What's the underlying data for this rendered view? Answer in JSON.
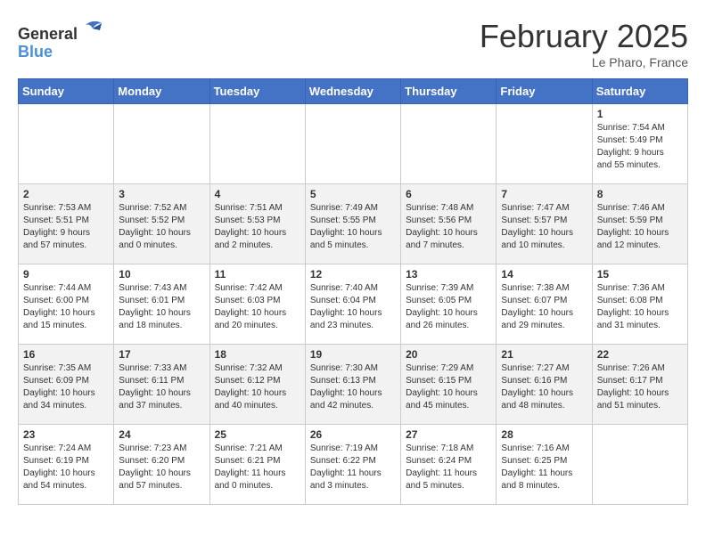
{
  "header": {
    "logo_general": "General",
    "logo_blue": "Blue",
    "month_title": "February 2025",
    "subtitle": "Le Pharo, France"
  },
  "weekdays": [
    "Sunday",
    "Monday",
    "Tuesday",
    "Wednesday",
    "Thursday",
    "Friday",
    "Saturday"
  ],
  "weeks": [
    [
      {
        "day": "",
        "info": ""
      },
      {
        "day": "",
        "info": ""
      },
      {
        "day": "",
        "info": ""
      },
      {
        "day": "",
        "info": ""
      },
      {
        "day": "",
        "info": ""
      },
      {
        "day": "",
        "info": ""
      },
      {
        "day": "1",
        "info": "Sunrise: 7:54 AM\nSunset: 5:49 PM\nDaylight: 9 hours\nand 55 minutes."
      }
    ],
    [
      {
        "day": "2",
        "info": "Sunrise: 7:53 AM\nSunset: 5:51 PM\nDaylight: 9 hours\nand 57 minutes."
      },
      {
        "day": "3",
        "info": "Sunrise: 7:52 AM\nSunset: 5:52 PM\nDaylight: 10 hours\nand 0 minutes."
      },
      {
        "day": "4",
        "info": "Sunrise: 7:51 AM\nSunset: 5:53 PM\nDaylight: 10 hours\nand 2 minutes."
      },
      {
        "day": "5",
        "info": "Sunrise: 7:49 AM\nSunset: 5:55 PM\nDaylight: 10 hours\nand 5 minutes."
      },
      {
        "day": "6",
        "info": "Sunrise: 7:48 AM\nSunset: 5:56 PM\nDaylight: 10 hours\nand 7 minutes."
      },
      {
        "day": "7",
        "info": "Sunrise: 7:47 AM\nSunset: 5:57 PM\nDaylight: 10 hours\nand 10 minutes."
      },
      {
        "day": "8",
        "info": "Sunrise: 7:46 AM\nSunset: 5:59 PM\nDaylight: 10 hours\nand 12 minutes."
      }
    ],
    [
      {
        "day": "9",
        "info": "Sunrise: 7:44 AM\nSunset: 6:00 PM\nDaylight: 10 hours\nand 15 minutes."
      },
      {
        "day": "10",
        "info": "Sunrise: 7:43 AM\nSunset: 6:01 PM\nDaylight: 10 hours\nand 18 minutes."
      },
      {
        "day": "11",
        "info": "Sunrise: 7:42 AM\nSunset: 6:03 PM\nDaylight: 10 hours\nand 20 minutes."
      },
      {
        "day": "12",
        "info": "Sunrise: 7:40 AM\nSunset: 6:04 PM\nDaylight: 10 hours\nand 23 minutes."
      },
      {
        "day": "13",
        "info": "Sunrise: 7:39 AM\nSunset: 6:05 PM\nDaylight: 10 hours\nand 26 minutes."
      },
      {
        "day": "14",
        "info": "Sunrise: 7:38 AM\nSunset: 6:07 PM\nDaylight: 10 hours\nand 29 minutes."
      },
      {
        "day": "15",
        "info": "Sunrise: 7:36 AM\nSunset: 6:08 PM\nDaylight: 10 hours\nand 31 minutes."
      }
    ],
    [
      {
        "day": "16",
        "info": "Sunrise: 7:35 AM\nSunset: 6:09 PM\nDaylight: 10 hours\nand 34 minutes."
      },
      {
        "day": "17",
        "info": "Sunrise: 7:33 AM\nSunset: 6:11 PM\nDaylight: 10 hours\nand 37 minutes."
      },
      {
        "day": "18",
        "info": "Sunrise: 7:32 AM\nSunset: 6:12 PM\nDaylight: 10 hours\nand 40 minutes."
      },
      {
        "day": "19",
        "info": "Sunrise: 7:30 AM\nSunset: 6:13 PM\nDaylight: 10 hours\nand 42 minutes."
      },
      {
        "day": "20",
        "info": "Sunrise: 7:29 AM\nSunset: 6:15 PM\nDaylight: 10 hours\nand 45 minutes."
      },
      {
        "day": "21",
        "info": "Sunrise: 7:27 AM\nSunset: 6:16 PM\nDaylight: 10 hours\nand 48 minutes."
      },
      {
        "day": "22",
        "info": "Sunrise: 7:26 AM\nSunset: 6:17 PM\nDaylight: 10 hours\nand 51 minutes."
      }
    ],
    [
      {
        "day": "23",
        "info": "Sunrise: 7:24 AM\nSunset: 6:19 PM\nDaylight: 10 hours\nand 54 minutes."
      },
      {
        "day": "24",
        "info": "Sunrise: 7:23 AM\nSunset: 6:20 PM\nDaylight: 10 hours\nand 57 minutes."
      },
      {
        "day": "25",
        "info": "Sunrise: 7:21 AM\nSunset: 6:21 PM\nDaylight: 11 hours\nand 0 minutes."
      },
      {
        "day": "26",
        "info": "Sunrise: 7:19 AM\nSunset: 6:22 PM\nDaylight: 11 hours\nand 3 minutes."
      },
      {
        "day": "27",
        "info": "Sunrise: 7:18 AM\nSunset: 6:24 PM\nDaylight: 11 hours\nand 5 minutes."
      },
      {
        "day": "28",
        "info": "Sunrise: 7:16 AM\nSunset: 6:25 PM\nDaylight: 11 hours\nand 8 minutes."
      },
      {
        "day": "",
        "info": ""
      }
    ]
  ]
}
